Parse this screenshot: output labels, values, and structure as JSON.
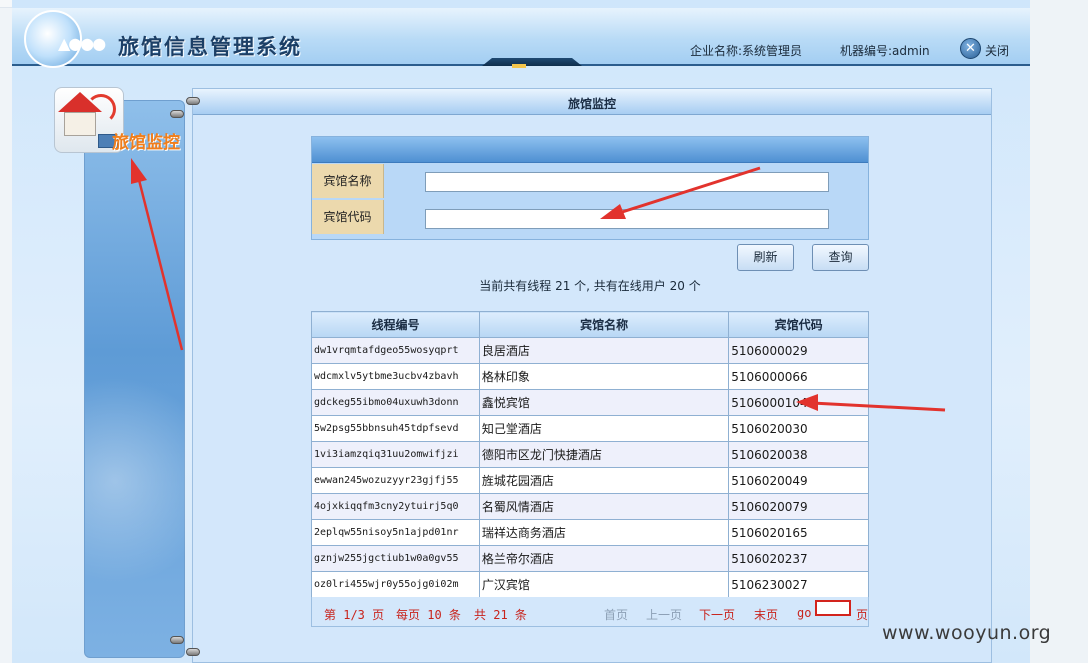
{
  "header": {
    "title": "旅馆信息管理系统",
    "company_label": "企业名称:系统管理员",
    "machine_label": "机器编号:admin",
    "close_label": "关闭"
  },
  "sidebar": {
    "items": [
      {
        "label": "旅馆监控",
        "icon": "hotel-monitor-icon"
      }
    ]
  },
  "panel": {
    "title": "旅馆监控"
  },
  "search": {
    "fields": [
      {
        "label": "宾馆名称",
        "value": ""
      },
      {
        "label": "宾馆代码",
        "value": ""
      }
    ],
    "refresh_label": "刷新",
    "query_label": "查询"
  },
  "status": {
    "text": "当前共有线程 21 个, 共有在线用户 20 个"
  },
  "table": {
    "columns": [
      "线程编号",
      "宾馆名称",
      "宾馆代码"
    ],
    "rows": [
      [
        "dw1vrqmtafdgeo55wosyqprt",
        "良居酒店",
        "5106000029"
      ],
      [
        "wdcmxlv5ytbme3ucbv4zbavh",
        "格林印象",
        "5106000066"
      ],
      [
        "gdckeg55ibmo04uxuwh3donn",
        "鑫悦宾馆",
        "5106000104"
      ],
      [
        "5w2psg55bbnsuh45tdpfsevd",
        "知己堂酒店",
        "5106020030"
      ],
      [
        "1vi3iamzqiq31uu2omwifjzi",
        "德阳市区龙门快捷酒店",
        "5106020038"
      ],
      [
        "ewwan245wozuzyyr23gjfj55",
        "旌城花园酒店",
        "5106020049"
      ],
      [
        "4ojxkiqqfm3cny2ytuirj5q0",
        "名蜀风情酒店",
        "5106020079"
      ],
      [
        "2eplqw55nisoy5n1ajpd01nr",
        "瑞祥达商务酒店",
        "5106020165"
      ],
      [
        "gznjw255jgctiub1w0a0gv55",
        "格兰帝尔酒店",
        "5106020237"
      ],
      [
        "oz0lri455wjr0y55ojg0i02m",
        "广汉宾馆",
        "5106230027"
      ]
    ]
  },
  "pager": {
    "page_info": "第 1/3 页",
    "per_page": "每页 10 条",
    "total": "共 21 条",
    "first": "首页",
    "prev": "上一页",
    "next": "下一页",
    "last": "末页",
    "go_label": "go",
    "go_value": "",
    "page_suffix": "页"
  },
  "colors": {
    "accent": "#4f90d2",
    "link_red": "#c8241d",
    "menu_orange": "#f07e1b",
    "annotation_red": "#e2332d"
  },
  "watermark": "www.wooyun.org"
}
